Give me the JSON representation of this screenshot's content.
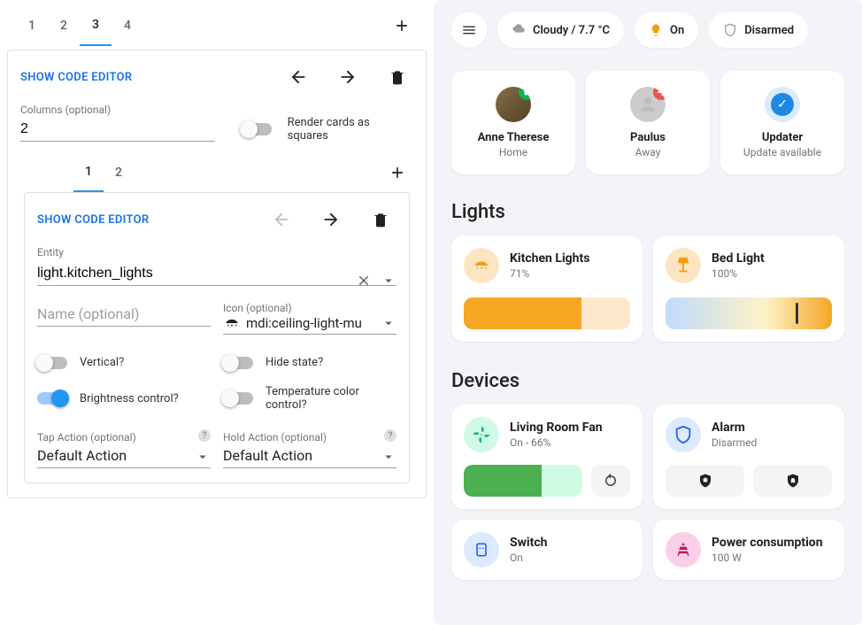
{
  "editor": {
    "outer_tabs": [
      "1",
      "2",
      "3",
      "4"
    ],
    "outer_active_index": 2,
    "show_code_editor": "SHOW CODE EDITOR",
    "columns_label": "Columns (optional)",
    "columns_value": "2",
    "render_squares_label": "Render cards as squares",
    "inner_tabs": [
      "1",
      "2"
    ],
    "inner_active_index": 0,
    "entity_label": "Entity",
    "entity_value": "light.kitchen_lights",
    "name_label": "Name (optional)",
    "name_value": "",
    "icon_label": "Icon (optional)",
    "icon_value": "mdi:ceiling-light-mu",
    "toggles": {
      "vertical": "Vertical?",
      "hide_state": "Hide state?",
      "brightness": "Brightness control?",
      "temperature": "Temperature color control?"
    },
    "tap_action_label": "Tap Action (optional)",
    "tap_action_value": "Default Action",
    "hold_action_label": "Hold Action (optional)",
    "hold_action_value": "Default Action"
  },
  "dashboard": {
    "chips": {
      "weather": "Cloudy / 7.7 °C",
      "state_on": "On",
      "alarm": "Disarmed"
    },
    "people": [
      {
        "name": "Anne Therese",
        "status": "Home",
        "badge": "home",
        "avatar": "anne"
      },
      {
        "name": "Paulus",
        "status": "Away",
        "badge": "away",
        "avatar": "generic"
      },
      {
        "name": "Updater",
        "status": "Update available",
        "badge": "",
        "avatar": "updater"
      }
    ],
    "lights_title": "Lights",
    "lights": [
      {
        "name": "Kitchen Lights",
        "status": "71%",
        "fill": 71,
        "type": "solid"
      },
      {
        "name": "Bed Light",
        "status": "100%",
        "fill": 100,
        "type": "grad"
      }
    ],
    "devices_title": "Devices",
    "fan": {
      "name": "Living Room Fan",
      "status": "On - 66%",
      "fill": 66
    },
    "alarm_card": {
      "name": "Alarm",
      "status": "Disarmed"
    },
    "switch": {
      "name": "Switch",
      "status": "On"
    },
    "power": {
      "name": "Power consumption",
      "status": "100 W"
    }
  }
}
